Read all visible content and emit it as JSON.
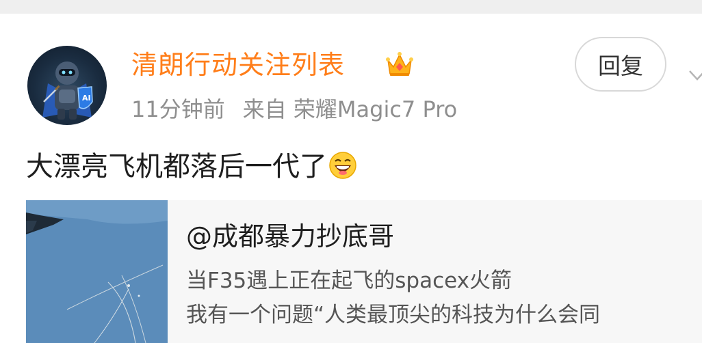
{
  "post": {
    "author": "清朗行动关注列表",
    "badge_icon": "vip-crown-icon",
    "time": "11分钟前",
    "source": "来自 荣耀Magic7 Pro",
    "reply_label": "回复",
    "text": "大漂亮飞机都落后一代了",
    "emoji": "laughing-face-emoji"
  },
  "repost": {
    "author": "@成都暴力抄底哥",
    "line1": "当F35遇上正在起飞的spacex火箭",
    "line2": "我有一个问题“人类最顶尖的科技为什么会同"
  },
  "colors": {
    "author_name": "#ff7e1a",
    "meta_text": "#8e8e8e",
    "card_bg": "#f7f7f7"
  }
}
